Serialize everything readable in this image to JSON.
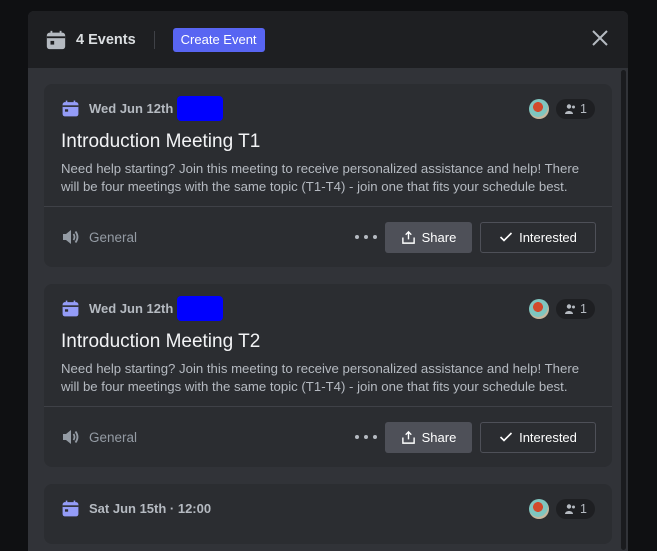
{
  "header": {
    "events_count": "4 Events",
    "create_event_label": "Create Event",
    "close_icon": "close-icon",
    "accent_color": "#5865f2"
  },
  "events": [
    {
      "date": "Wed Jun 12th",
      "title": "Introduction Meeting T1",
      "description": "Need help starting? Join this meeting to receive personalized assistance and help! There will be four meetings with the same topic (T1-T4) - join one that fits your schedule best.",
      "interested_count": "1",
      "channel": "General",
      "share_label": "Share",
      "interested_label": "Interested"
    },
    {
      "date": "Wed Jun 12th",
      "title": "Introduction Meeting T2",
      "description": "Need help starting? Join this meeting to receive personalized assistance and help! There will be four meetings with the same topic (T1-T4) - join one that fits your schedule best.",
      "interested_count": "1",
      "channel": "General",
      "share_label": "Share",
      "interested_label": "Interested"
    },
    {
      "date": "Sat Jun 15th · 12:00",
      "interested_count": "1"
    }
  ]
}
